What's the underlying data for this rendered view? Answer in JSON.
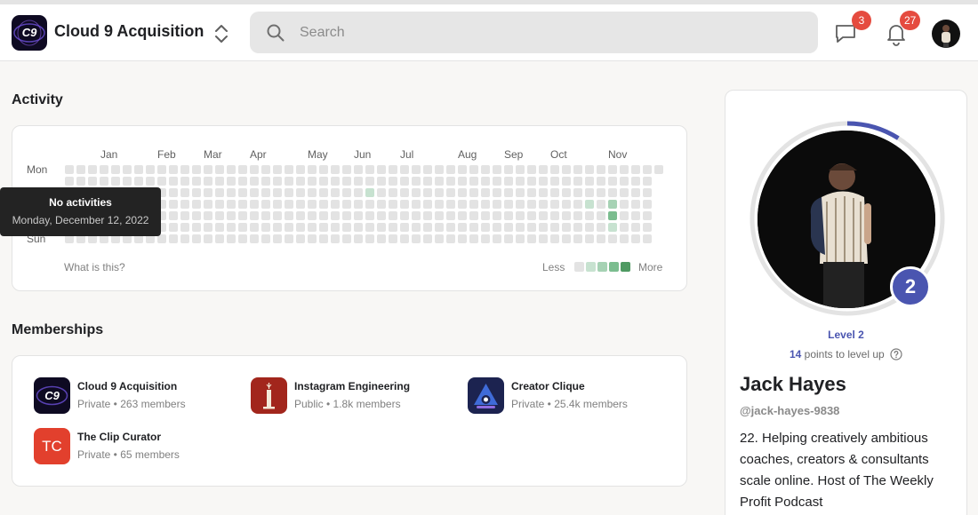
{
  "header": {
    "group_name": "Cloud 9 Acquisition",
    "logo_text": "C9",
    "search_placeholder": "Search",
    "chat_count": "3",
    "notification_count": "27"
  },
  "activity": {
    "title": "Activity",
    "months": [
      "Jan",
      "Feb",
      "Mar",
      "Apr",
      "May",
      "Jun",
      "Jul",
      "Aug",
      "Sep",
      "Oct",
      "Nov"
    ],
    "day_labels": [
      "Mon",
      "Sun"
    ],
    "what_is_this": "What is this?",
    "legend_less": "Less",
    "legend_more": "More",
    "legend_colors": [
      "#e3e3e3",
      "#c7e2d0",
      "#a6d2b4",
      "#7bbd8f",
      "#4f9a62"
    ],
    "active_cells": [
      {
        "week": 26,
        "day": 2,
        "level": 1
      },
      {
        "week": 45,
        "day": 3,
        "level": 1
      },
      {
        "week": 47,
        "day": 3,
        "level": 2
      },
      {
        "week": 47,
        "day": 4,
        "level": 3
      },
      {
        "week": 47,
        "day": 5,
        "level": 1
      }
    ],
    "tooltip": {
      "title": "No activities",
      "date": "Monday, December 12, 2022"
    }
  },
  "memberships": {
    "title": "Memberships",
    "items": [
      {
        "name": "Cloud 9 Acquisition",
        "meta": "Private • 263 members"
      },
      {
        "name": "Instagram Engineering",
        "meta": "Public • 1.8k members"
      },
      {
        "name": "Creator Clique",
        "meta": "Private • 25.4k members"
      },
      {
        "name": "The Clip Curator",
        "meta": "Private • 65 members",
        "initials": "TC"
      }
    ]
  },
  "profile": {
    "level_number": "2",
    "level_label": "Level 2",
    "points": "14",
    "points_suffix": "points to level up",
    "level_progress": 0.09,
    "name": "Jack Hayes",
    "handle": "@jack-hayes-9838",
    "bio": "22. Helping creatively ambitious coaches, creators & consultants scale online. Host of The Weekly Profit Podcast"
  },
  "colors": {
    "accent": "#4a55b0",
    "badge": "#e54b3f",
    "tc_red": "#e2402d",
    "instagram_red": "#a2261c",
    "creator_navy": "#1c2350"
  }
}
